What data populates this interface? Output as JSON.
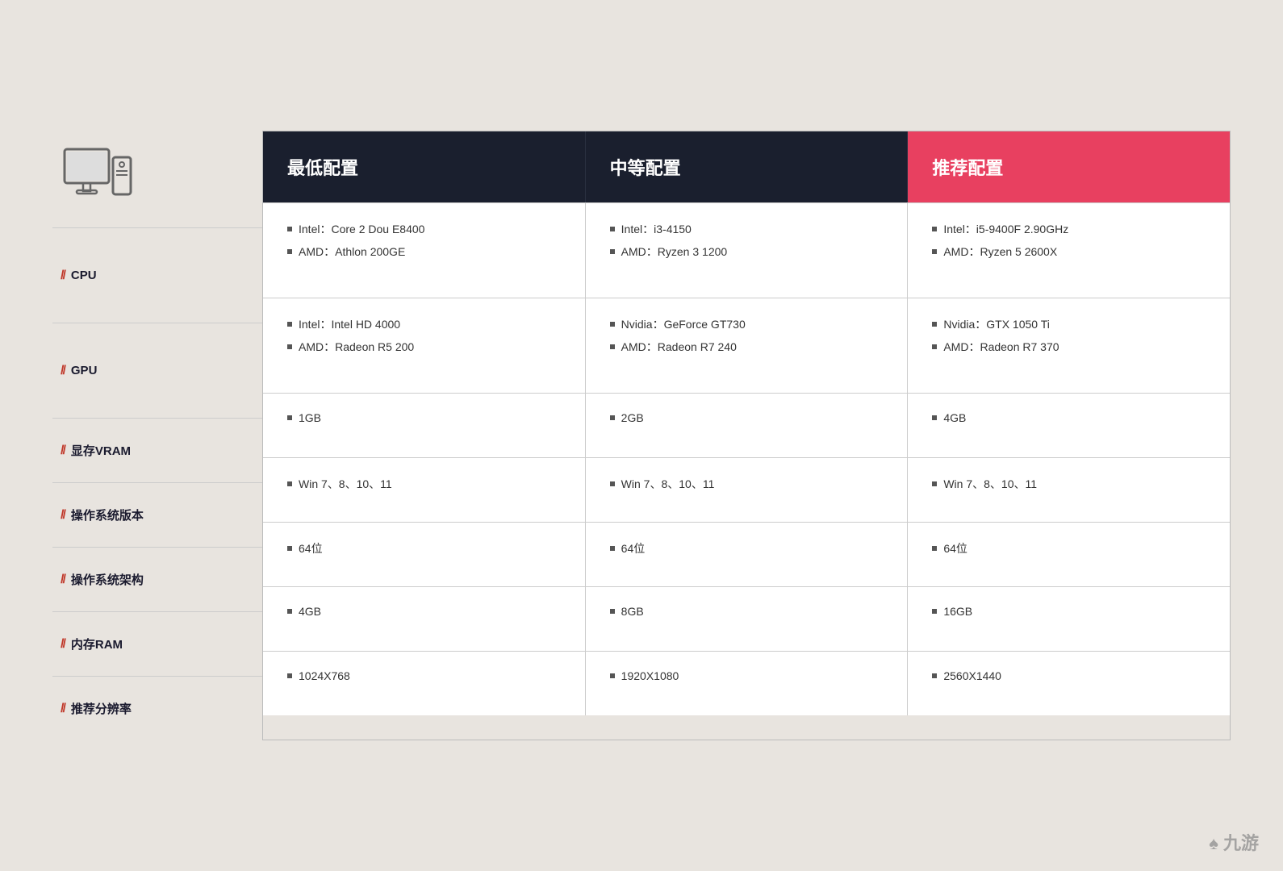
{
  "header": {
    "min_config_label": "最低配置",
    "mid_config_label": "中等配置",
    "rec_config_label": "推荐配置"
  },
  "rows": [
    {
      "id": "cpu",
      "label": "CPU",
      "height_class": "row-h-cpu",
      "min": [
        "Intel：Core 2 Dou E8400",
        "AMD：Athlon 200GE"
      ],
      "mid": [
        "Intel：i3-4150",
        "AMD：Ryzen 3 1200"
      ],
      "rec": [
        "Intel：i5-9400F 2.90GHz",
        "AMD：Ryzen 5 2600X"
      ]
    },
    {
      "id": "gpu",
      "label": "GPU",
      "height_class": "row-h-gpu",
      "min": [
        "Intel：Intel HD 4000",
        "AMD：Radeon R5 200"
      ],
      "mid": [
        "Nvidia：GeForce GT730",
        "AMD：Radeon R7 240"
      ],
      "rec": [
        "Nvidia：GTX 1050 Ti",
        "AMD：Radeon R7 370"
      ]
    },
    {
      "id": "vram",
      "label": "显存VRAM",
      "height_class": "row-h-vram",
      "min": [
        "1GB"
      ],
      "mid": [
        "2GB"
      ],
      "rec": [
        "4GB"
      ]
    },
    {
      "id": "os-version",
      "label": "操作系统版本",
      "height_class": "row-h-os-ver",
      "min": [
        "Win 7、8、10、11"
      ],
      "mid": [
        "Win 7、8、10、11"
      ],
      "rec": [
        "Win 7、8、10、11"
      ]
    },
    {
      "id": "os-arch",
      "label": "操作系统架构",
      "height_class": "row-h-os-arch",
      "min": [
        "64位"
      ],
      "mid": [
        "64位"
      ],
      "rec": [
        "64位"
      ]
    },
    {
      "id": "ram",
      "label": "内存RAM",
      "height_class": "row-h-ram",
      "min": [
        "4GB"
      ],
      "mid": [
        "8GB"
      ],
      "rec": [
        "16GB"
      ]
    },
    {
      "id": "resolution",
      "label": "推荐分辨率",
      "height_class": "row-h-res",
      "min": [
        "1024X768"
      ],
      "mid": [
        "1920X1080"
      ],
      "rec": [
        "2560X1440"
      ]
    }
  ],
  "watermark": "♠ 九游"
}
